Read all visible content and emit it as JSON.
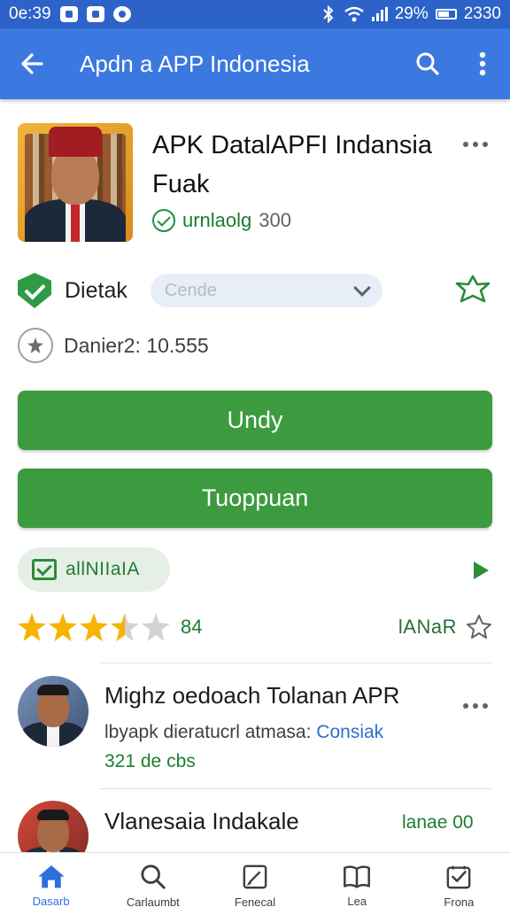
{
  "status_bar": {
    "time_left": "0e:39",
    "battery": "29%",
    "time_right": "2330"
  },
  "app_bar": {
    "title": "Apdn a APP Indonesia"
  },
  "app": {
    "name": "APK DatalAPFI Indansia Fuak",
    "downloads_label": "urnlaolg",
    "downloads_count": "300"
  },
  "verified": {
    "label": "Dietak",
    "select_value": "Cende"
  },
  "developer": {
    "text": "Danier2: 10.555"
  },
  "buttons": {
    "primary": "Undy",
    "secondary": "Tuoppuan"
  },
  "chip": {
    "label": "allNIIaIA"
  },
  "rating": {
    "stars": 3.5,
    "max": 5,
    "count": "84",
    "link": "lANaR"
  },
  "reviews": [
    {
      "name": "Mighz oedoach Tolanan APR",
      "text": "lbyapk dieratucrl atmasa:",
      "link": "Consiak",
      "date": "321 de cbs"
    },
    {
      "name": "Vlanesaia Indakale",
      "text": "",
      "link": "",
      "date": "",
      "meta": "lanae 00"
    }
  ],
  "bottom_nav": [
    {
      "label": "Dasarb",
      "icon": "home-icon"
    },
    {
      "label": "Carlaumbt",
      "icon": "search-icon"
    },
    {
      "label": "Fenecal",
      "icon": "edit-icon"
    },
    {
      "label": "Lea",
      "icon": "book-icon"
    },
    {
      "label": "Frona",
      "icon": "check-box-icon"
    }
  ],
  "colors": {
    "status_bar": "#2d63c8",
    "app_bar": "#3b78e0",
    "accent_green": "#3c9b3f",
    "star_gold": "#f5b400",
    "link_blue": "#2d6fd0"
  }
}
